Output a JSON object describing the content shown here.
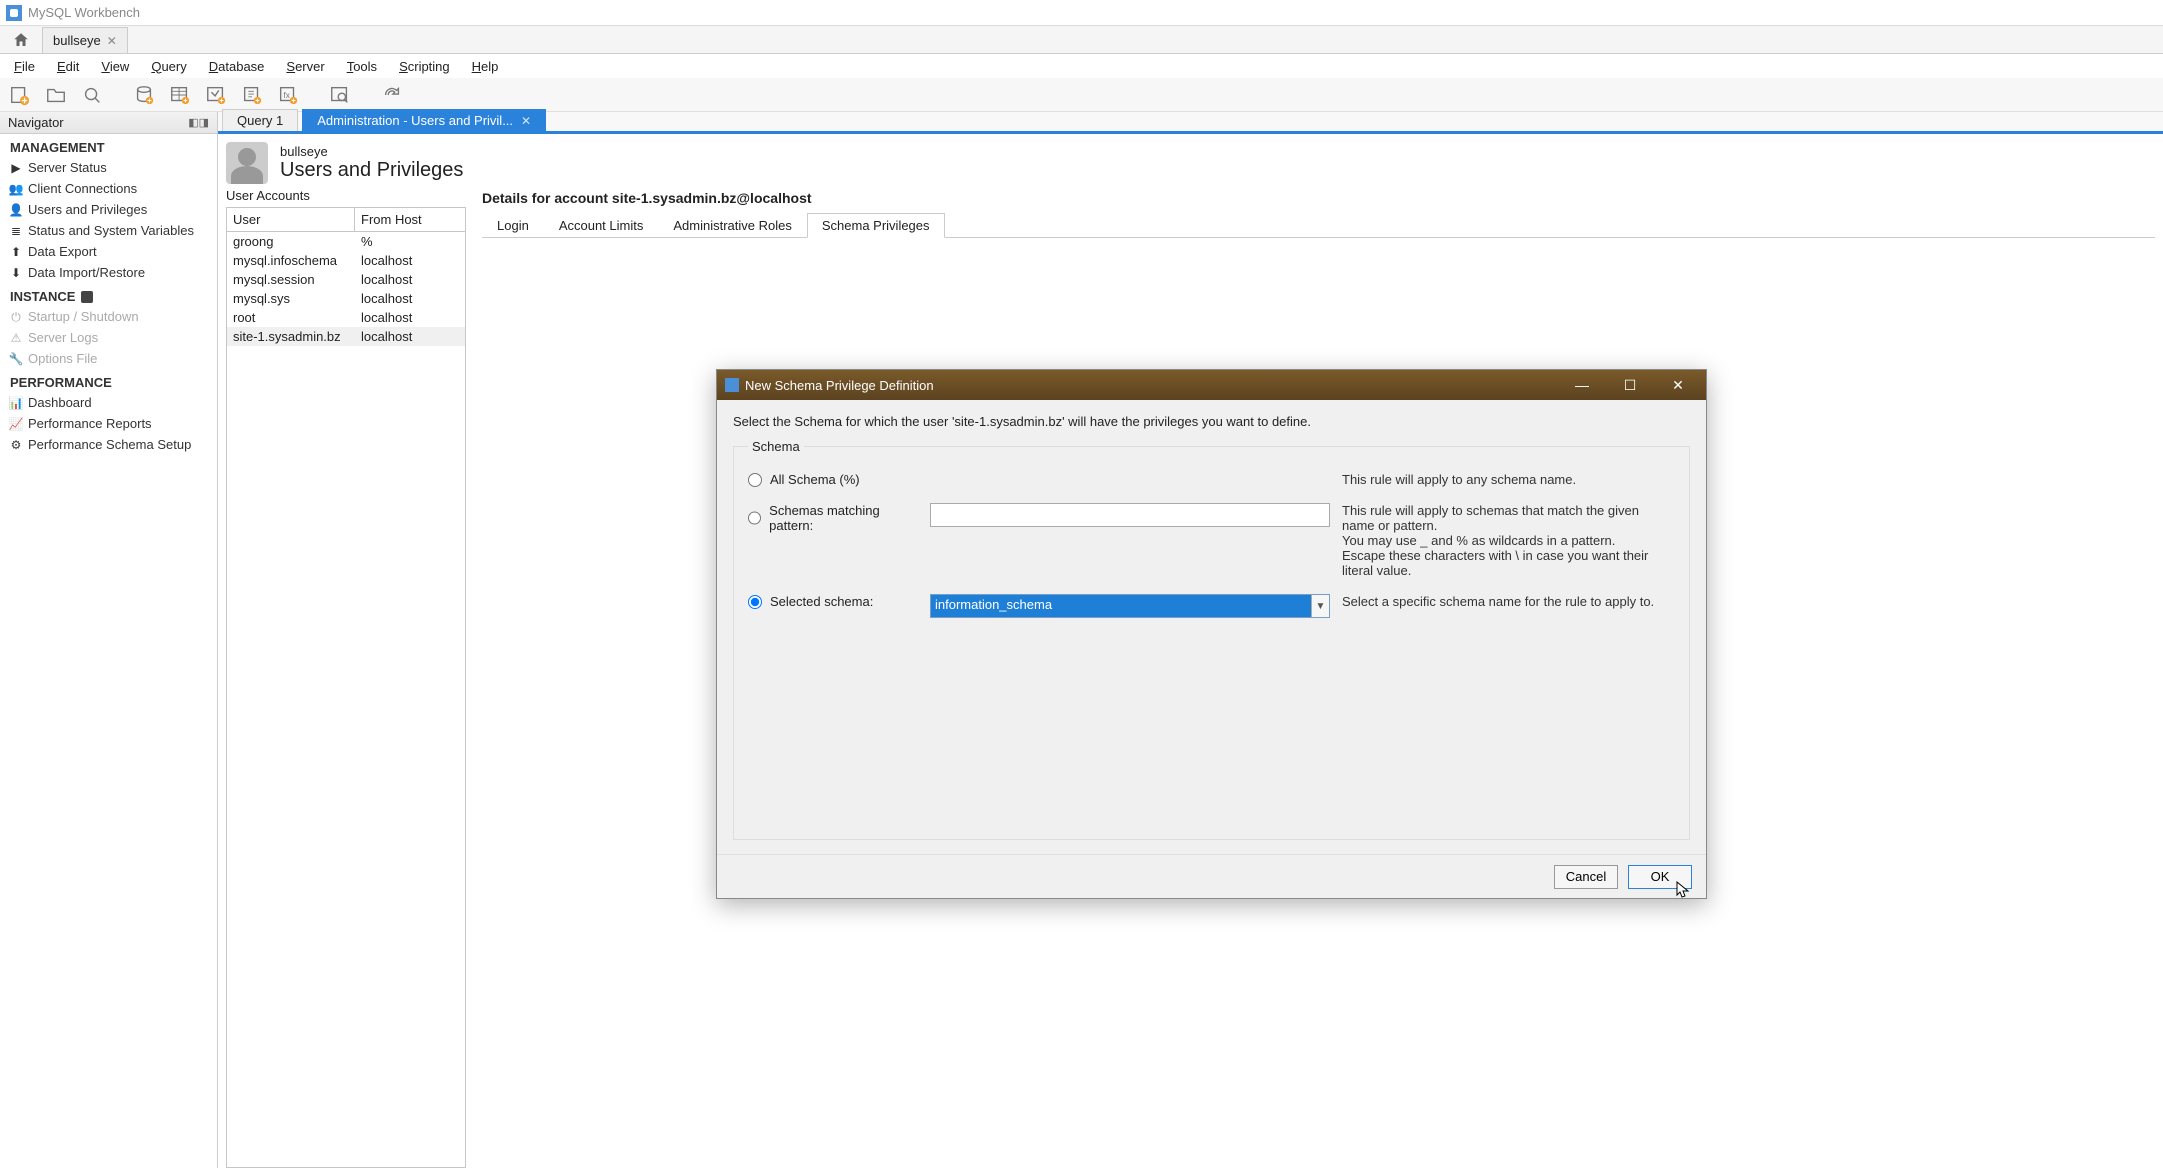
{
  "app_title": "MySQL Workbench",
  "connection_tab": "bullseye",
  "menu": [
    "File",
    "Edit",
    "View",
    "Query",
    "Database",
    "Server",
    "Tools",
    "Scripting",
    "Help"
  ],
  "menu_underline_idx": [
    0,
    0,
    0,
    0,
    0,
    0,
    0,
    0,
    0
  ],
  "navigator_title": "Navigator",
  "management": {
    "heading": "MANAGEMENT",
    "items": [
      "Server Status",
      "Client Connections",
      "Users and Privileges",
      "Status and System Variables",
      "Data Export",
      "Data Import/Restore"
    ]
  },
  "instance": {
    "heading": "INSTANCE",
    "items": [
      "Startup / Shutdown",
      "Server Logs",
      "Options File"
    ]
  },
  "performance": {
    "heading": "PERFORMANCE",
    "items": [
      "Dashboard",
      "Performance Reports",
      "Performance Schema Setup"
    ]
  },
  "doc_tabs": [
    {
      "label": "Query 1",
      "active": false
    },
    {
      "label": "Administration - Users and Privil...",
      "active": true
    }
  ],
  "page": {
    "sub": "bullseye",
    "title": "Users and Privileges",
    "accounts_label": "User Accounts",
    "columns": [
      "User",
      "From Host"
    ],
    "rows": [
      {
        "user": "groong",
        "host": "%"
      },
      {
        "user": "mysql.infoschema",
        "host": "localhost"
      },
      {
        "user": "mysql.session",
        "host": "localhost"
      },
      {
        "user": "mysql.sys",
        "host": "localhost"
      },
      {
        "user": "root",
        "host": "localhost"
      },
      {
        "user": "site-1.sysadmin.bz",
        "host": "localhost",
        "selected": true
      }
    ],
    "details_title": "Details for account site-1.sysadmin.bz@localhost",
    "sub_tabs": [
      "Login",
      "Account Limits",
      "Administrative Roles",
      "Schema Privileges"
    ],
    "active_sub_tab": "Schema Privileges"
  },
  "dialog": {
    "title": "New Schema Privilege Definition",
    "instruction": "Select the Schema for which the user 'site-1.sysadmin.bz' will have the privileges you want to define.",
    "group_label": "Schema",
    "opt_all": "All Schema (%)",
    "opt_all_desc": "This rule will apply to any schema name.",
    "opt_pattern": "Schemas matching pattern:",
    "opt_pattern_desc": "This rule will apply to schemas that match the given name or pattern.\nYou may use _ and % as wildcards in a pattern.\nEscape these characters with \\ in case you want their literal value.",
    "opt_selected": "Selected schema:",
    "opt_selected_desc": "Select a specific schema name for the rule to apply to.",
    "selected_value": "information_schema",
    "cancel": "Cancel",
    "ok": "OK"
  }
}
